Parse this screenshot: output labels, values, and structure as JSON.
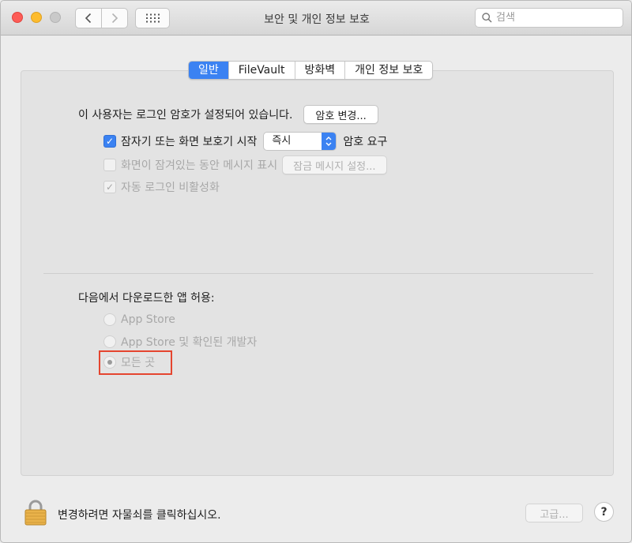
{
  "window": {
    "title": "보안 및 개인 정보 보호"
  },
  "search": {
    "placeholder": "검색"
  },
  "tabs": [
    {
      "label": "일반",
      "active": true
    },
    {
      "label": "FileVault",
      "active": false
    },
    {
      "label": "방화벽",
      "active": false
    },
    {
      "label": "개인 정보 보호",
      "active": false
    }
  ],
  "general": {
    "password_set_text": "이 사용자는 로그인 암호가 설정되어 있습니다.",
    "change_password_button": "암호 변경...",
    "require_password": {
      "label": "잠자기 또는 화면 보호기 시작",
      "checked": true,
      "delay_value": "즉시",
      "suffix": "암호 요구"
    },
    "show_message": {
      "label": "화면이 잠겨있는 동안 메시지 표시",
      "checked": false,
      "button": "잠금 메시지 설정..."
    },
    "disable_auto_login": {
      "label": "자동 로그인 비활성화",
      "checked": true
    }
  },
  "downloads": {
    "heading": "다음에서 다운로드한 앱 허용:",
    "options": [
      {
        "label": "App Store",
        "selected": false
      },
      {
        "label": "App Store 및 확인된 개발자",
        "selected": false
      },
      {
        "label": "모든 곳",
        "selected": true
      }
    ]
  },
  "footer": {
    "lock_text": "변경하려면 자물쇠를 클릭하십시오.",
    "advanced_button": "고급...",
    "help_button": "?"
  },
  "colors": {
    "accent": "#3b82f2",
    "highlight_box": "#e5452f"
  }
}
